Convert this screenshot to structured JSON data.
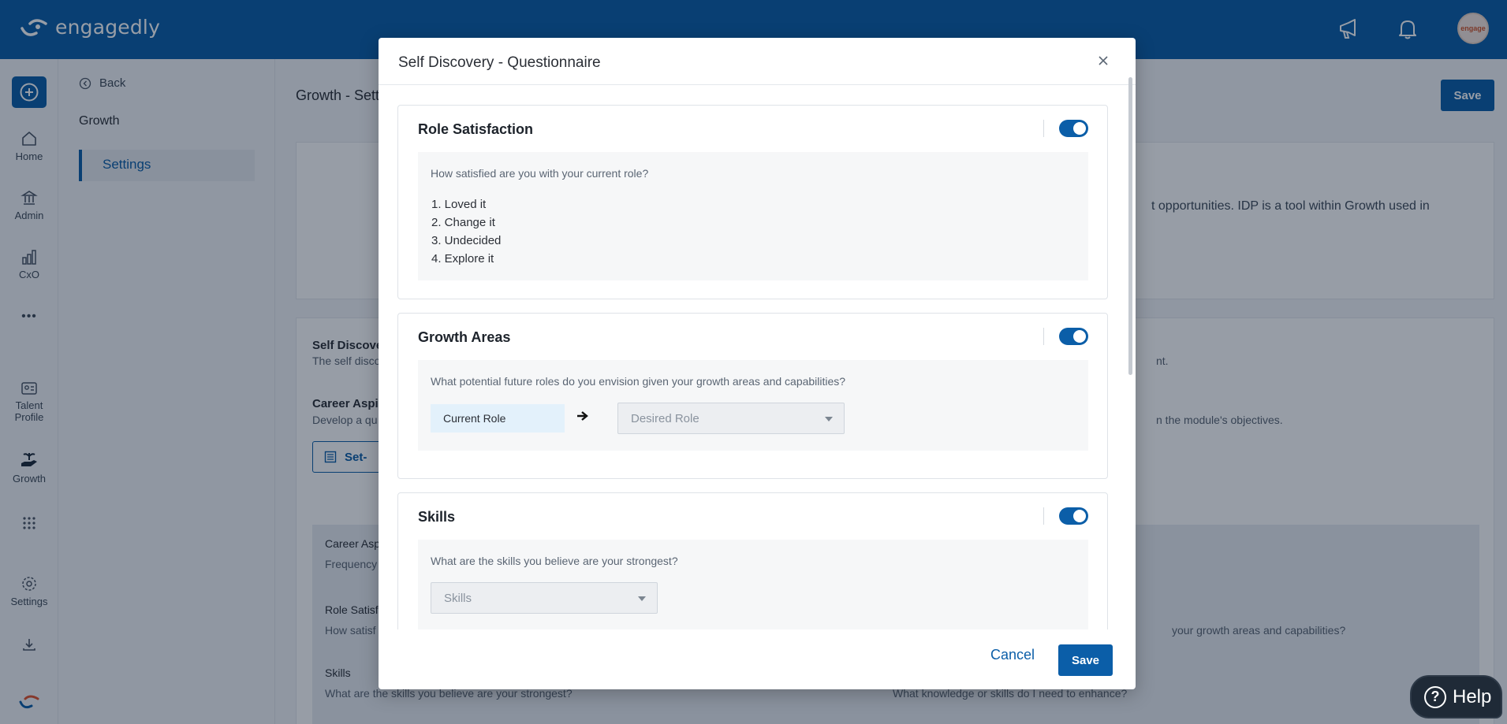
{
  "app": {
    "brand": "engagedly",
    "avatar_text": "engage"
  },
  "leftnav": {
    "items": [
      {
        "label": "Home",
        "icon": "home-icon"
      },
      {
        "label": "Admin",
        "icon": "admin-icon"
      },
      {
        "label": "CxO",
        "icon": "chart-icon"
      },
      {
        "label": "Talent Profile",
        "icon": "id-card-icon"
      },
      {
        "label": "Growth",
        "icon": "growth-icon"
      },
      {
        "label": "Settings",
        "icon": "gear-icon"
      }
    ]
  },
  "sidebar": {
    "back_label": "Back",
    "section": "Growth",
    "active_item": "Settings"
  },
  "main": {
    "title": "Growth - Sett",
    "save_label": "Save",
    "card1_text": "t opportunities. IDP is a tool within Growth used in",
    "section1_title": "Self Discove",
    "section1_desc": "The self disco",
    "section1_desc_right": "nt.",
    "section2_title": "Career Aspi",
    "section2_desc": "Develop a qu",
    "section2_desc_right": "n the module's objectives.",
    "setup_button": "Set-",
    "box": {
      "r1_label": "Career Asp",
      "r1_value": "Frequency",
      "r2_label": "Role Satisf",
      "r2_value": "How satisf",
      "r2_right": "your growth areas and capabilities?",
      "r3_label": "Skills",
      "r3_value": "What are the skills you believe are your strongest?",
      "r3_right": "What knowledge or skills do I need to enhance?"
    }
  },
  "modal": {
    "title": "Self Discovery - Questionnaire",
    "sections": [
      {
        "title": "Role Satisfaction",
        "enabled": true,
        "question": "How satisfied are you with your current role?",
        "options": [
          "1. Loved it",
          "2. Change it",
          "3. Undecided",
          "4. Explore it"
        ]
      },
      {
        "title": "Growth Areas",
        "enabled": true,
        "question": "What potential future roles do you envision given your growth areas and capabilities?",
        "current_role": "Current Role",
        "desired_role_placeholder": "Desired Role"
      },
      {
        "title": "Skills",
        "enabled": true,
        "question": "What are the skills you believe are your strongest?",
        "skills_placeholder": "Skills"
      }
    ],
    "cancel_label": "Cancel",
    "save_label": "Save"
  },
  "help": {
    "label": "Help"
  },
  "colors": {
    "brand": "#0b5ea8",
    "overlay": "rgba(8,22,44,0.42)"
  }
}
